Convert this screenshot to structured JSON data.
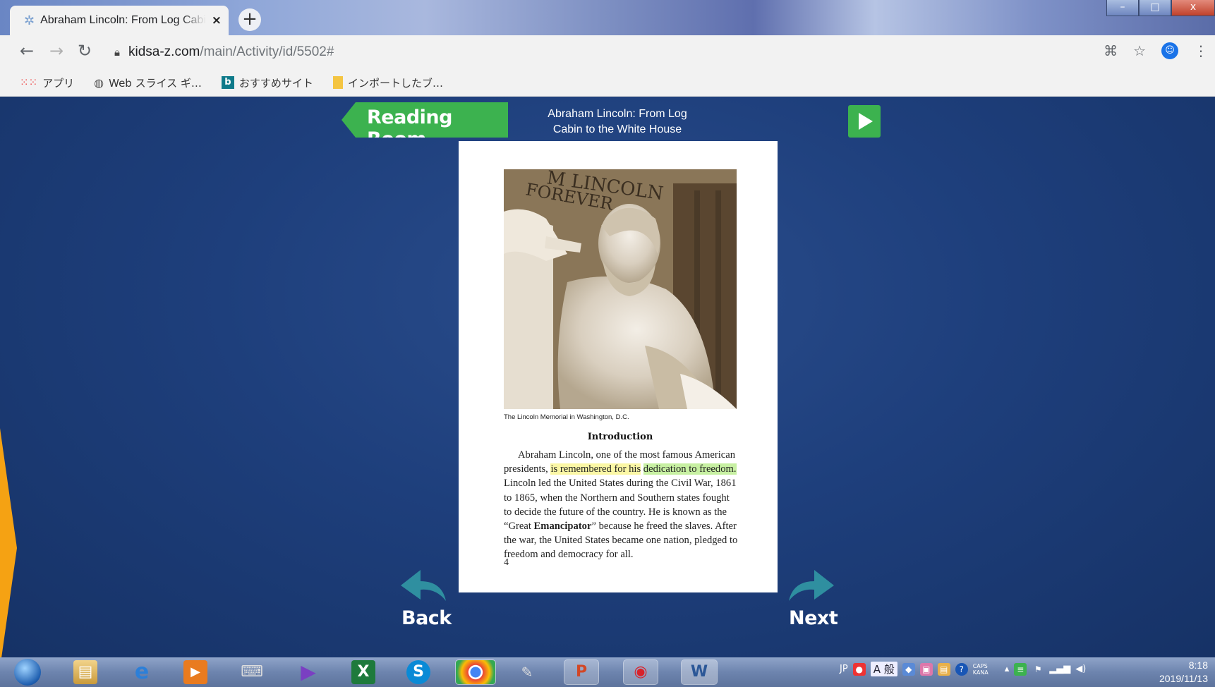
{
  "browser": {
    "tab_title": "Abraham Lincoln: From Log Cabin",
    "tab_close": "×",
    "new_tab": "+",
    "url_host": "kidsa-z.com",
    "url_path": "/main/Activity/id/5502#",
    "window_minimize": "–",
    "window_maximize": "□",
    "window_close": "x"
  },
  "bookmarks": [
    {
      "label": "アプリ",
      "icon": "apps-grid-icon"
    },
    {
      "label": "Web スライス ギ…",
      "icon": "globe-icon"
    },
    {
      "label": "おすすめサイト",
      "icon": "bing-icon"
    },
    {
      "label": "インポートしたブ…",
      "icon": "folder-icon"
    }
  ],
  "reader": {
    "banner": "Reading Room",
    "book_title_line1": "Abraham Lincoln: From Log",
    "book_title_line2": "Cabin to the White House",
    "back_label": "Back",
    "next_label": "Next"
  },
  "page": {
    "photo_inscription_1": "M LINCOLN",
    "photo_inscription_2": "FOREVER",
    "caption": "The Lincoln Memorial in Washington, D.C.",
    "heading": "Introduction",
    "text_1": "Abraham Lincoln, one of the most famous American presidents, ",
    "highlight_1": "is remembered for his",
    "highlight_2": "dedication to freedom.",
    "text_2": " Lincoln led the United States during the Civil War, 1861 to 1865, when the Northern and Southern states fought to decide the future of the country. He is known as the “Great ",
    "bold_word": "Emancipator",
    "text_3": "” because he freed the slaves. After the war, the United States became one nation, pledged to freedom and democracy for all.",
    "page_number": "4"
  },
  "taskbar": {
    "lang": "JP",
    "ime": "A 般",
    "caps": "CAPS KANA",
    "time": "8:18",
    "date": "2019/11/13"
  },
  "colors": {
    "banner_green": "#3cb24f",
    "arrow_teal": "#2f8fa0",
    "background_blue": "#1e3f7c",
    "highlight_yellow": "#fbf7a5",
    "highlight_green": "#c7f0a2"
  }
}
